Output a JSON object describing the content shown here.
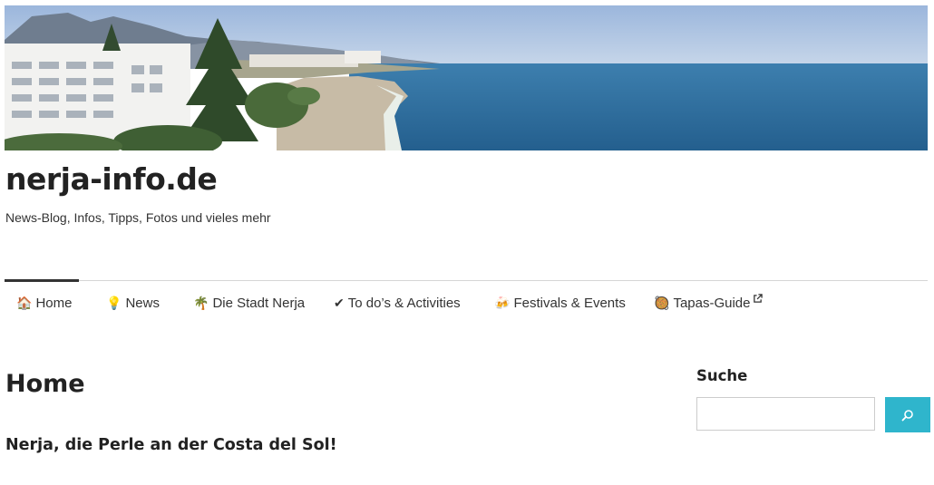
{
  "site": {
    "title": "nerja-info.de",
    "tagline": "News-Blog, Infos, Tipps, Fotos und vieles mehr"
  },
  "header_image": "beach-panorama",
  "nav": {
    "items": [
      {
        "label": "Home",
        "icon": "house-icon",
        "glyph": "🏠",
        "active": true
      },
      {
        "label": "News",
        "icon": "lightbulb-icon",
        "glyph": "💡"
      },
      {
        "label": "Die Stadt Nerja",
        "icon": "palm-tree-icon",
        "glyph": "🌴"
      },
      {
        "label": "To do’s & Activities",
        "icon": "checkmark-icon",
        "glyph": "✔"
      },
      {
        "label": "Festivals & Events",
        "icon": "beer-mugs-icon",
        "glyph": "🍻"
      },
      {
        "label": "Tapas-Guide",
        "icon": "tapas-icon",
        "glyph": "🥘",
        "external": true
      }
    ]
  },
  "main": {
    "page_title": "Home",
    "post_heading": "Nerja, die Perle an der Costa del Sol!"
  },
  "sidebar": {
    "search_title": "Suche",
    "search_value": ""
  },
  "colors": {
    "accent": "#2fb5cc",
    "text": "#222222",
    "rule": "#d6d6d6"
  }
}
